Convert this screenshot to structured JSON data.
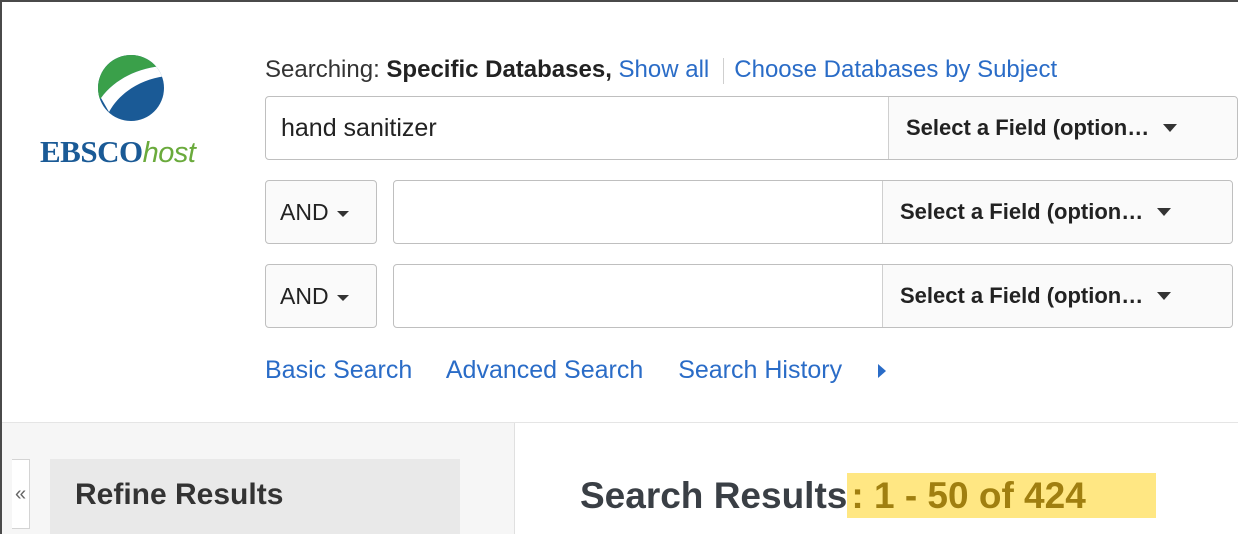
{
  "logo": {
    "brand": "EBSCO",
    "suffix": "host"
  },
  "searching": {
    "label": "Searching:",
    "scope": "Specific Databases,",
    "show_all": "Show all",
    "choose_db": "Choose Databases by Subject"
  },
  "rows": [
    {
      "query": "hand sanitizer",
      "field": "Select a Field (option…"
    },
    {
      "operator": "AND",
      "query": "",
      "field": "Select a Field (option…"
    },
    {
      "operator": "AND",
      "query": "",
      "field": "Select a Field (option…"
    }
  ],
  "links": {
    "basic": "Basic Search",
    "advanced": "Advanced Search",
    "history": "Search History"
  },
  "sidebar": {
    "collapse": "«",
    "refine_title": "Refine Results"
  },
  "results": {
    "title": "Search Results",
    "count": ": 1 - 50 of 424"
  },
  "colors": {
    "link": "#2a6cc7",
    "highlight": "#ffe783",
    "brand_blue": "#1a5a96",
    "brand_green": "#6aaa3c"
  }
}
